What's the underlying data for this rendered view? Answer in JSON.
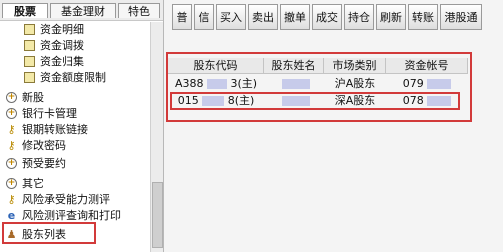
{
  "tabs": [
    "股票",
    "基金理财",
    "特色"
  ],
  "tree": [
    {
      "icon": "doc-icon",
      "label": "资金明细"
    },
    {
      "icon": "doc-icon",
      "label": "资金调拨"
    },
    {
      "icon": "doc-icon",
      "label": "资金归集"
    },
    {
      "icon": "doc-icon",
      "label": "资金额度限制"
    },
    {
      "icon": "plus-icon",
      "label": "新股"
    },
    {
      "icon": "plus-icon",
      "label": "银行卡管理"
    },
    {
      "icon": "key-icon",
      "label": "银期转账链接"
    },
    {
      "icon": "key-icon",
      "label": "修改密码"
    },
    {
      "icon": "plus-icon",
      "label": "预受要约"
    },
    {
      "icon": "plus-icon",
      "label": "其它"
    },
    {
      "icon": "key-icon",
      "label": "风险承受能力测评"
    },
    {
      "icon": "e-icon",
      "label": "风险测评查询和打印"
    },
    {
      "icon": "person-icon",
      "label": "股东列表"
    }
  ],
  "toolbar": [
    "普",
    "信",
    "买入",
    "卖出",
    "撤单",
    "成交",
    "持仓",
    "刷新",
    "转账",
    "港股通"
  ],
  "table": {
    "columns": [
      "股东代码",
      "股东姓名",
      "市场类别",
      "资金帐号"
    ],
    "rows": [
      [
        "A388",
        "3(主)",
        "",
        "沪A股东",
        "079"
      ],
      [
        "015",
        "8(主)",
        "",
        "深A股东",
        "078"
      ]
    ]
  },
  "colors": {
    "highlight": "#d23a3a",
    "redaction": "#b4b9e6"
  }
}
